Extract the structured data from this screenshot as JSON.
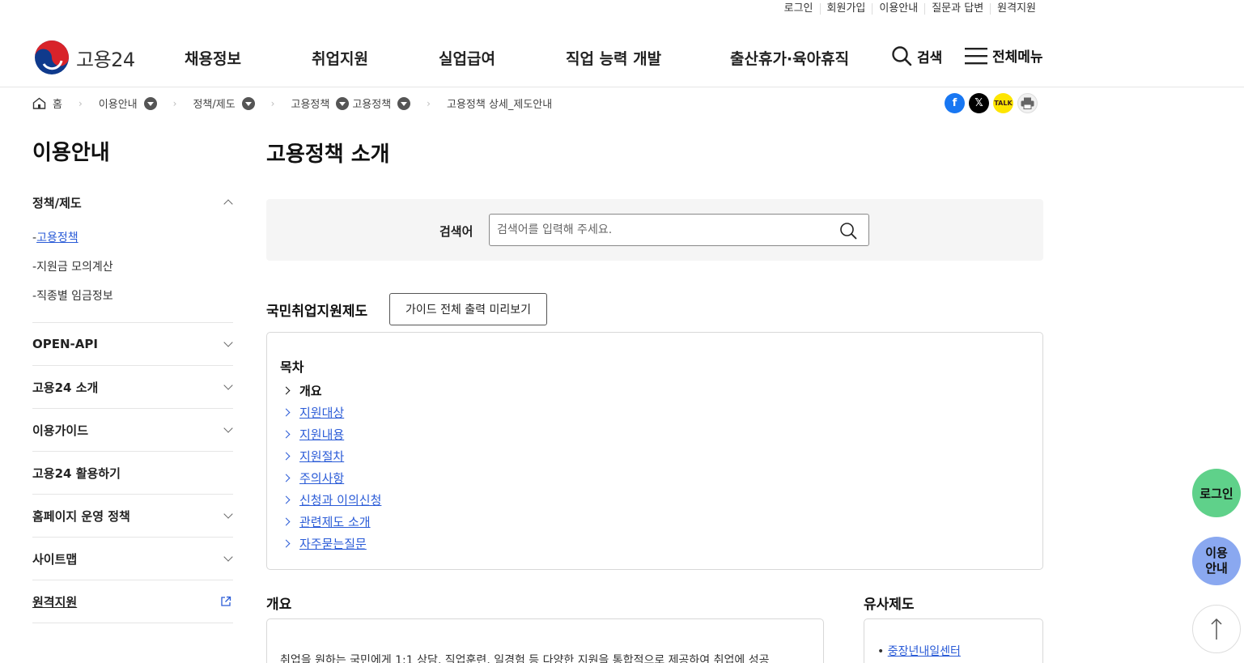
{
  "util": [
    "로그인",
    "회원가입",
    "이용안내",
    "질문과 답변",
    "원격지원"
  ],
  "logo": "고용24",
  "gnb": [
    "채용정보",
    "취업지원",
    "실업급여",
    "직업 능력 개발",
    "출산휴가·육아휴직"
  ],
  "header": {
    "search": "검색",
    "menu": "전체메뉴"
  },
  "breadcrumb": [
    "홈",
    "이용안내",
    "정책/제도",
    "고용정책",
    "고용정책",
    "고용정책 상세_제도안내"
  ],
  "lnb": {
    "title": "이용안내",
    "groups": [
      {
        "label": "정책/제도",
        "subs": [
          "고용정책",
          "지원금 모의계산",
          "직종별 임금정보"
        ]
      },
      {
        "label": "OPEN-API"
      },
      {
        "label": "고용24 소개"
      },
      {
        "label": "이용가이드"
      },
      {
        "label": "고용24 활용하기"
      },
      {
        "label": "홈페이지 운영 정책"
      },
      {
        "label": "사이트맵"
      },
      {
        "label": "원격지원"
      }
    ]
  },
  "main": {
    "title": "고용정책 소개",
    "search_label": "검색어",
    "search_placeholder": "검색어를 입력해 주세요.",
    "section_title": "국민취업지원제도",
    "guide_button": "가이드 전체 출력 미리보기",
    "toc_title": "목차",
    "toc": [
      "개요",
      "지원대상",
      "지원내용",
      "지원절차",
      "주의사항",
      "신청과 이의신청",
      "관련제도 소개",
      "자주묻는질문"
    ],
    "overview_title": "개요",
    "overview_text": "취업을 원하는 국민에게 1:1 상담, 직업훈련, 일경험 등 다양한 지원을 통합적으로 제공하여 취업에 성공",
    "similar_title": "유사제도",
    "similar_item": "중장년내일센터"
  },
  "floating": {
    "login": "로그인",
    "guide_1": "이용",
    "guide_2": "안내",
    "top": "↑"
  },
  "colors": {
    "link": "#2a5bd7",
    "login_fab": "#5fd18a",
    "guide_fab": "#8aa8f0"
  }
}
